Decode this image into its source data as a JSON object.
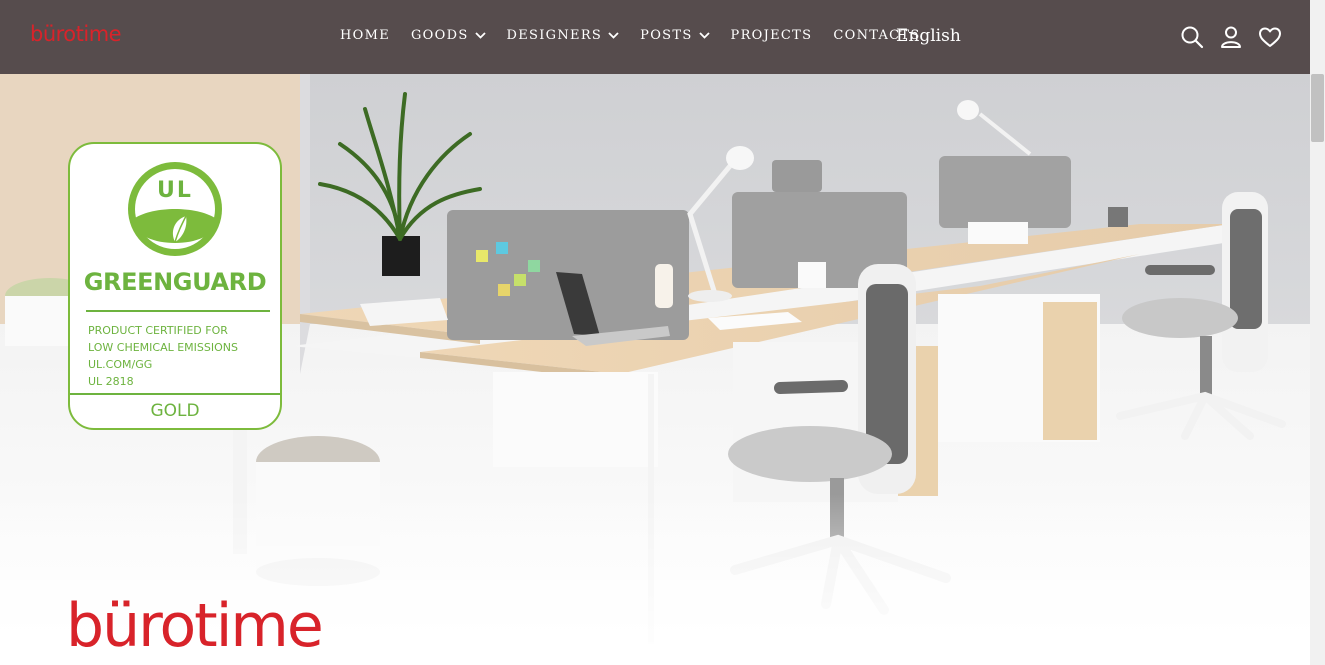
{
  "brand": {
    "name": "bürotime",
    "color": "#d8232a"
  },
  "nav": {
    "background": "#564c4d",
    "items": [
      {
        "label": "HOME",
        "dropdown": false
      },
      {
        "label": "GOODS",
        "dropdown": true
      },
      {
        "label": "DESIGNERS",
        "dropdown": true
      },
      {
        "label": "POSTS",
        "dropdown": true
      },
      {
        "label": "PROJECTS",
        "dropdown": false
      },
      {
        "label": "CONTACTS",
        "dropdown": false
      }
    ],
    "language": "English",
    "icons": [
      "search-icon",
      "user-icon",
      "heart-icon"
    ]
  },
  "badge": {
    "color": "#6db33f",
    "mark": "UL",
    "title": "GREENGUARD",
    "lines": [
      "PRODUCT CERTIFIED FOR",
      "LOW CHEMICAL EMISSIONS",
      "UL.COM/GG",
      "UL 2818"
    ],
    "level": "GOLD"
  },
  "hero": {
    "brand_text": "bürotime"
  }
}
